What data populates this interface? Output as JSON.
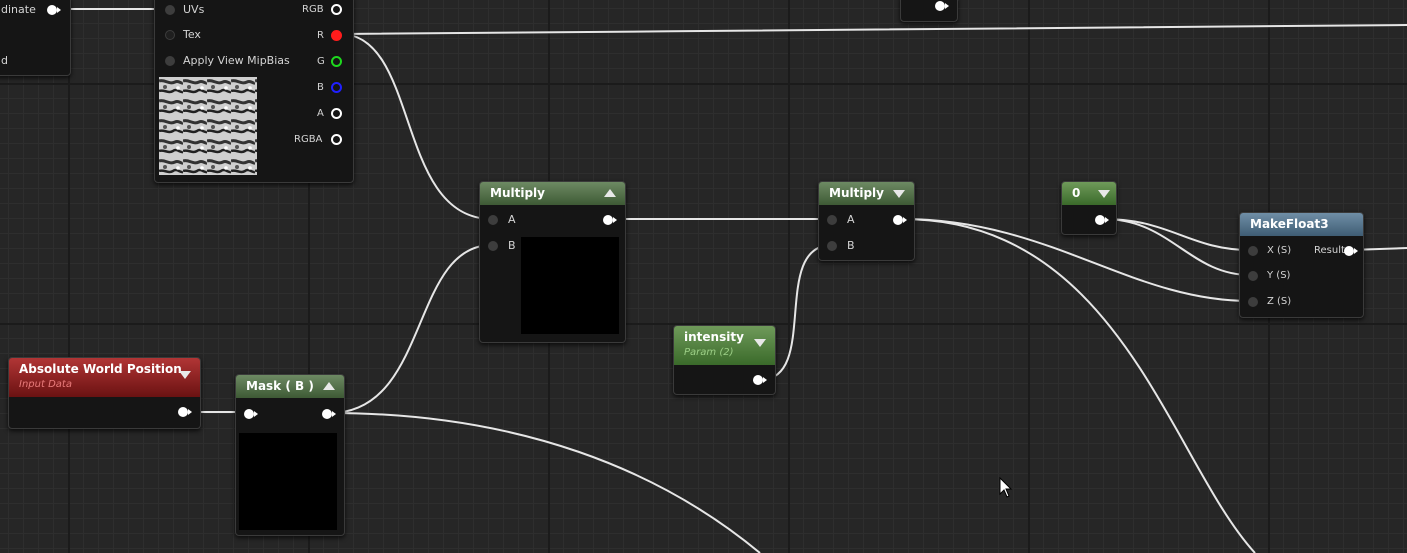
{
  "app": "Material Editor Graph",
  "nodes": {
    "coord_partial": {
      "label1": "dinate",
      "label2": "d"
    },
    "texture_sample": {
      "inputs": [
        "UVs",
        "Tex",
        "Apply View MipBias"
      ],
      "outputs": [
        "RGB",
        "R",
        "G",
        "B",
        "A",
        "RGBA"
      ]
    },
    "multiply1": {
      "title": "Multiply",
      "pin_a": "A",
      "pin_b": "B"
    },
    "multiply2": {
      "title": "Multiply",
      "pin_a": "A",
      "pin_b": "B"
    },
    "constant0": {
      "title": "0"
    },
    "makefloat3": {
      "title": "MakeFloat3",
      "pin_x": "X (S)",
      "pin_y": "Y (S)",
      "pin_z": "Z (S)",
      "result": "Result"
    },
    "intensity": {
      "title": "intensity",
      "subtitle": "Param (2)"
    },
    "absolute_world_position": {
      "title": "Absolute World Position",
      "subtitle": "Input Data"
    },
    "mask": {
      "title": "Mask ( B )"
    }
  },
  "colors": {
    "grid": "#262626",
    "wire": "#e6e6e6",
    "pin_r": "#ff1c1c",
    "pin_g": "#1ed81e",
    "pin_b": "#2020ff"
  },
  "icons": [
    "collapse-arrow-icon",
    "expand-arrow-icon",
    "mouse-cursor-icon"
  ]
}
